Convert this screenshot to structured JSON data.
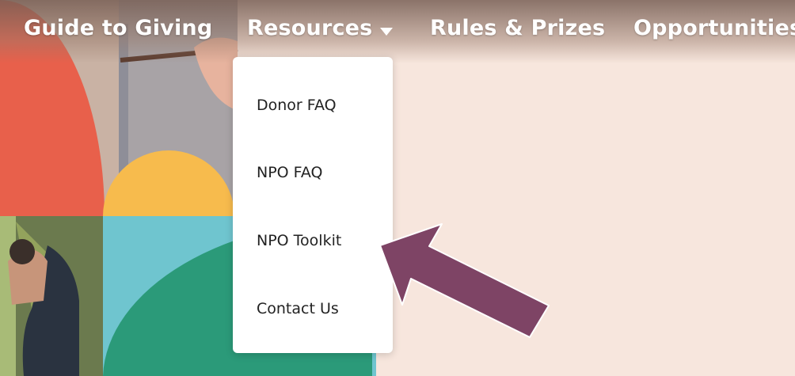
{
  "nav": {
    "items": [
      {
        "label": "Guide to Giving"
      },
      {
        "label": "Resources",
        "has_dropdown": true
      },
      {
        "label": "Rules & Prizes"
      },
      {
        "label": "Opportunities"
      }
    ]
  },
  "dropdown": {
    "items": [
      {
        "label": "Donor FAQ"
      },
      {
        "label": "NPO FAQ"
      },
      {
        "label": "NPO Toolkit"
      },
      {
        "label": "Contact Us"
      }
    ]
  },
  "colors": {
    "background": "#f7e6dd",
    "nav_text": "#ffffff",
    "shape_coral": "#e8604b",
    "shape_yellow": "#f7bb4d",
    "shape_teal": "#6fc5cf",
    "shape_green": "#2b9a79",
    "annotation_arrow": "#7e4465"
  },
  "icons": {
    "dropdown_caret": "caret-down-icon",
    "annotation": "annotation-arrow-icon"
  }
}
